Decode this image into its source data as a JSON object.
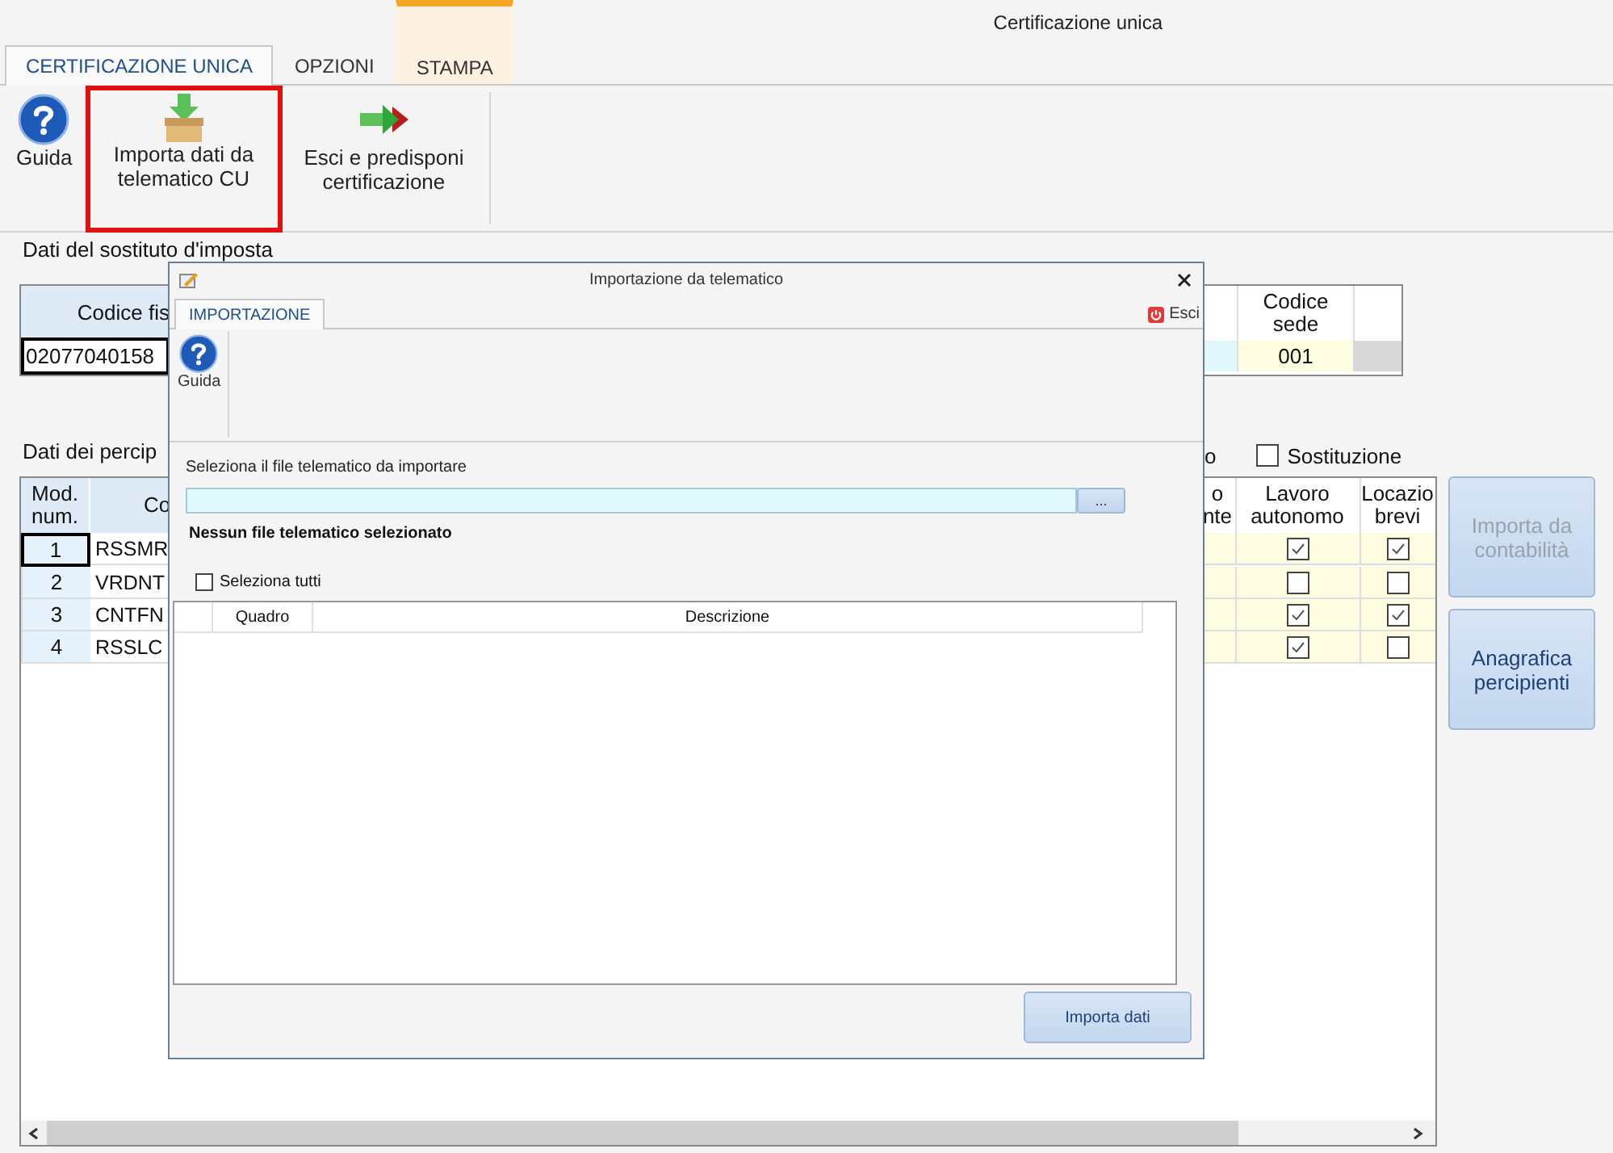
{
  "app": {
    "title": "Certificazione unica"
  },
  "tabs": [
    {
      "label": "CERTIFICAZIONE UNICA",
      "selected": true,
      "contextual": false
    },
    {
      "label": "OPZIONI",
      "selected": false,
      "contextual": false
    },
    {
      "label": "STAMPA",
      "selected": false,
      "contextual": true
    }
  ],
  "ribbon": [
    {
      "kind": "help",
      "label": "Guida",
      "outlined": false
    },
    {
      "kind": "import",
      "label": "Importa dati da telematico CU",
      "outlined": true
    },
    {
      "kind": "exit",
      "label": "Esci e predisponi certificazione",
      "outlined": false
    }
  ],
  "sostituto": {
    "heading": "Dati del sostituto d'imposta",
    "header_code": "Codice fis",
    "value_code": "02077040158",
    "header_sede": "Codice sede",
    "value_sede": "001"
  },
  "percipienti": {
    "heading": "Dati dei percip",
    "option_fragment": "o",
    "substitution": {
      "label": "Sostituzione",
      "checked": false
    },
    "columns": {
      "mod": "Mod. num.",
      "code": "Co",
      "fragment": "o nte",
      "lavoro": "Lavoro autonomo",
      "locazioni": "Locazio brevi"
    },
    "rows": [
      {
        "num": "1",
        "code": "RSSMR",
        "lavoro": true,
        "locazioni": true,
        "focused": true
      },
      {
        "num": "2",
        "code": "VRDNT",
        "lavoro": false,
        "locazioni": false,
        "focused": false
      },
      {
        "num": "3",
        "code": "CNTFN",
        "lavoro": true,
        "locazioni": true,
        "focused": false
      },
      {
        "num": "4",
        "code": "RSSLC",
        "lavoro": true,
        "locazioni": false,
        "focused": false
      }
    ]
  },
  "side_buttons": [
    {
      "label": "Importa da contabilità",
      "disabled": true
    },
    {
      "label": "Anagrafica percipienti",
      "disabled": false
    }
  ],
  "dialog": {
    "title": "Importazione da telematico",
    "tab": {
      "label": "IMPORTAZIONE",
      "selected": true
    },
    "exit": "Esci",
    "guide": "Guida",
    "file_label": "Seleziona il file telematico da importare",
    "browse": "...",
    "status": "Nessun file telematico selezionato",
    "select_all": {
      "label": "Seleziona tutti",
      "checked": false
    },
    "grid_columns": [
      "Quadro",
      "Descrizione"
    ],
    "action": "Importa dati"
  }
}
